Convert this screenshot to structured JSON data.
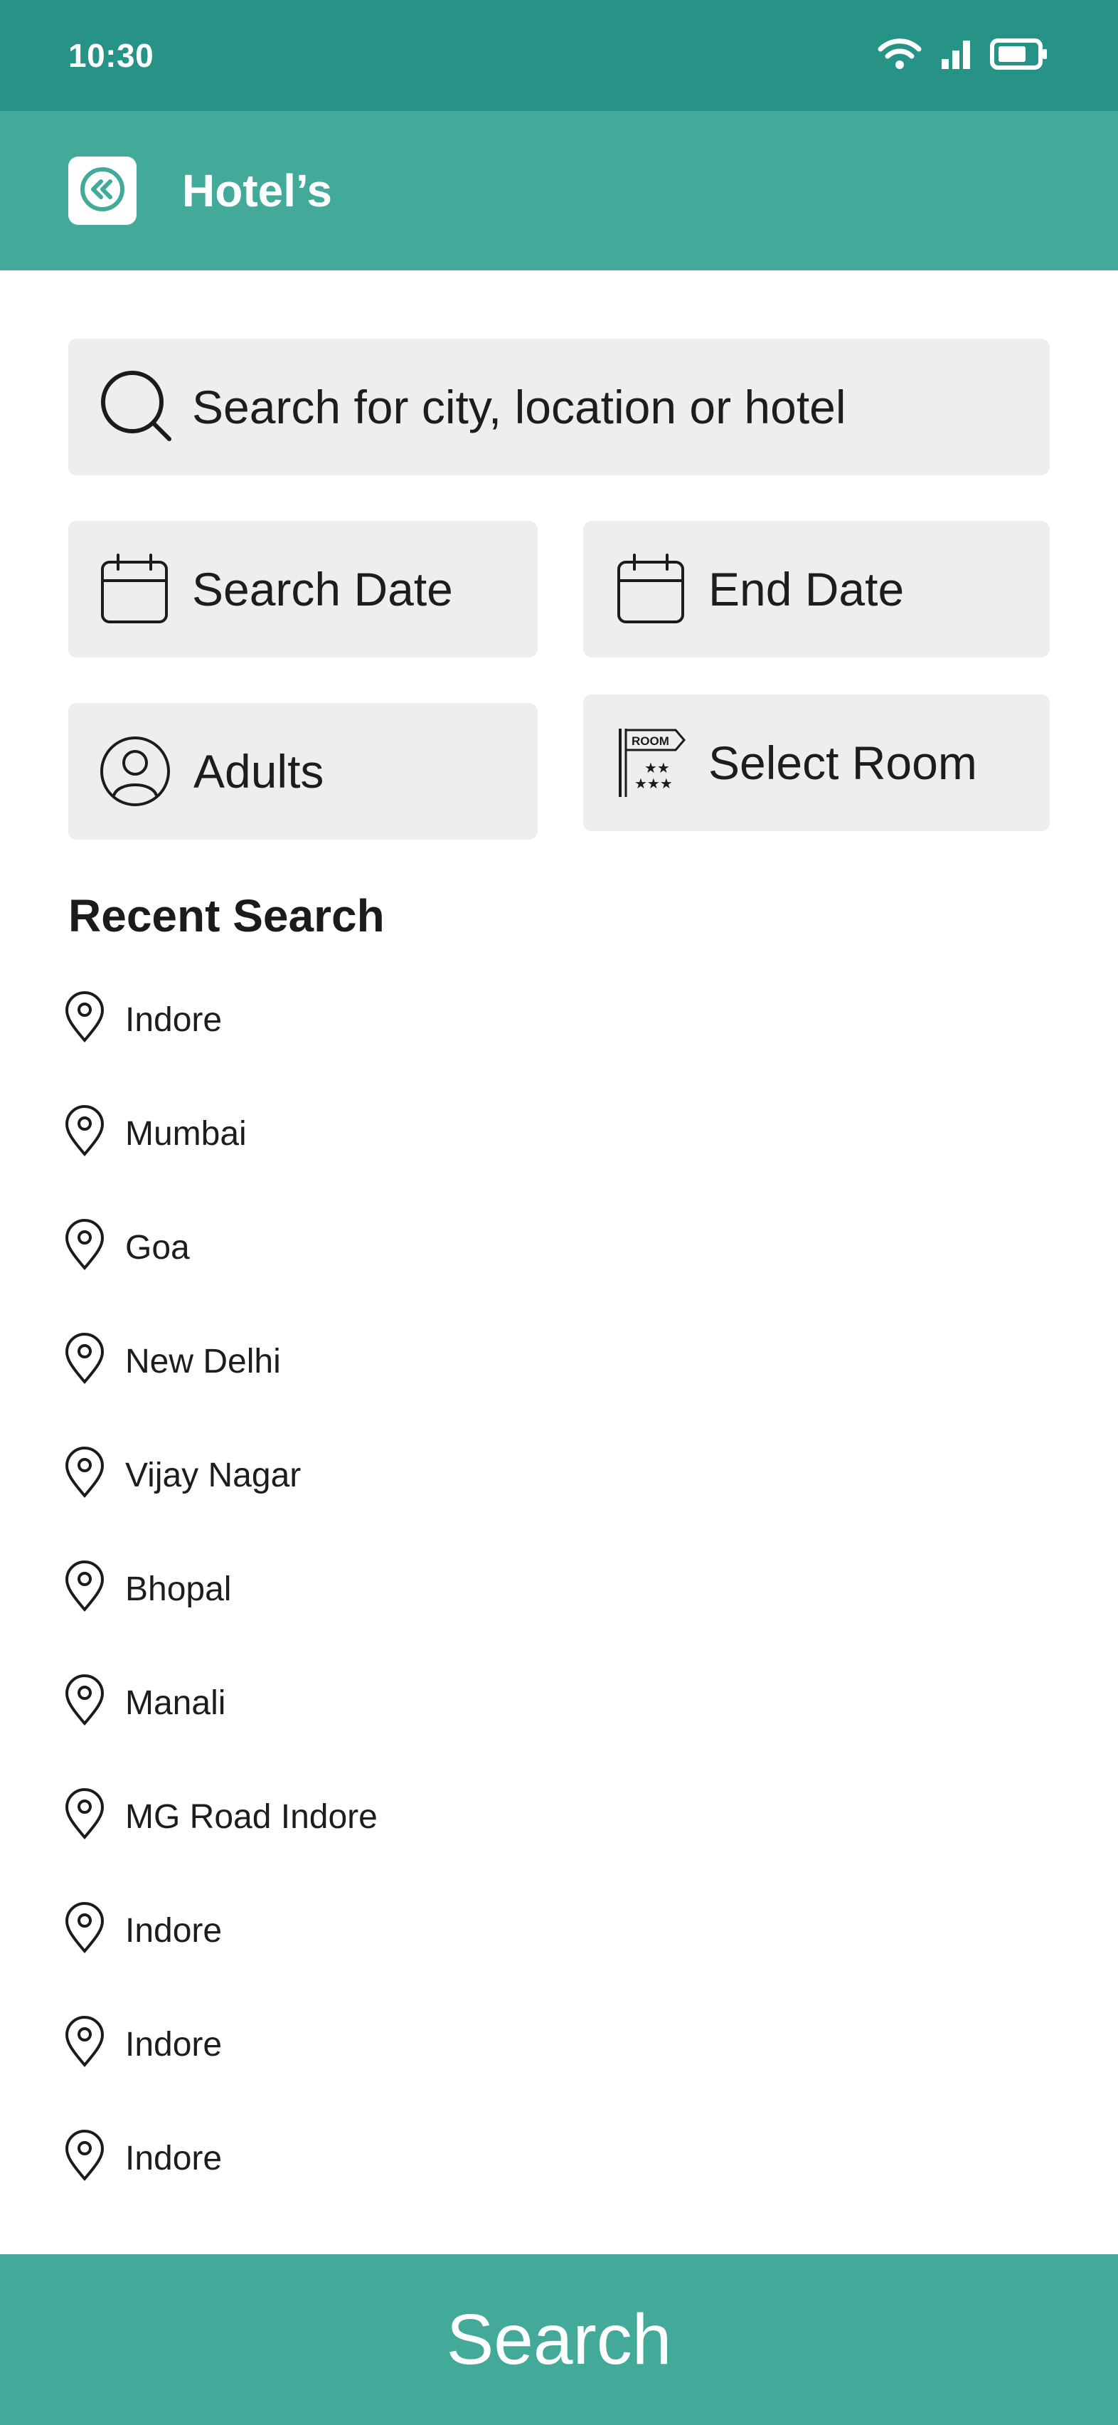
{
  "status_bar": {
    "time": "10:30",
    "icons": [
      "wifi-icon",
      "signal-icon",
      "battery-icon"
    ]
  },
  "header": {
    "title": "Hotel’s",
    "back_icon": "double-chevron-left-icon"
  },
  "search": {
    "placeholder": "Search for city, location or hotel"
  },
  "filters": {
    "start_date": "Search Date",
    "end_date": "End Date",
    "adults": "Adults",
    "room": "Select Room",
    "room_sign_text": "ROOM"
  },
  "recent": {
    "title": "Recent Search",
    "items": [
      "Indore",
      "Mumbai",
      "Goa",
      "New Delhi",
      "Vijay Nagar",
      "Bhopal",
      "Manali",
      "MG Road Indore",
      "Indore",
      "Indore",
      "Indore"
    ]
  },
  "actions": {
    "search_label": "Search"
  },
  "colors": {
    "status_bar": "#279286",
    "app_bar": "#43aa9a",
    "field_bg": "#eeeeee",
    "text": "#1b1b1b"
  }
}
